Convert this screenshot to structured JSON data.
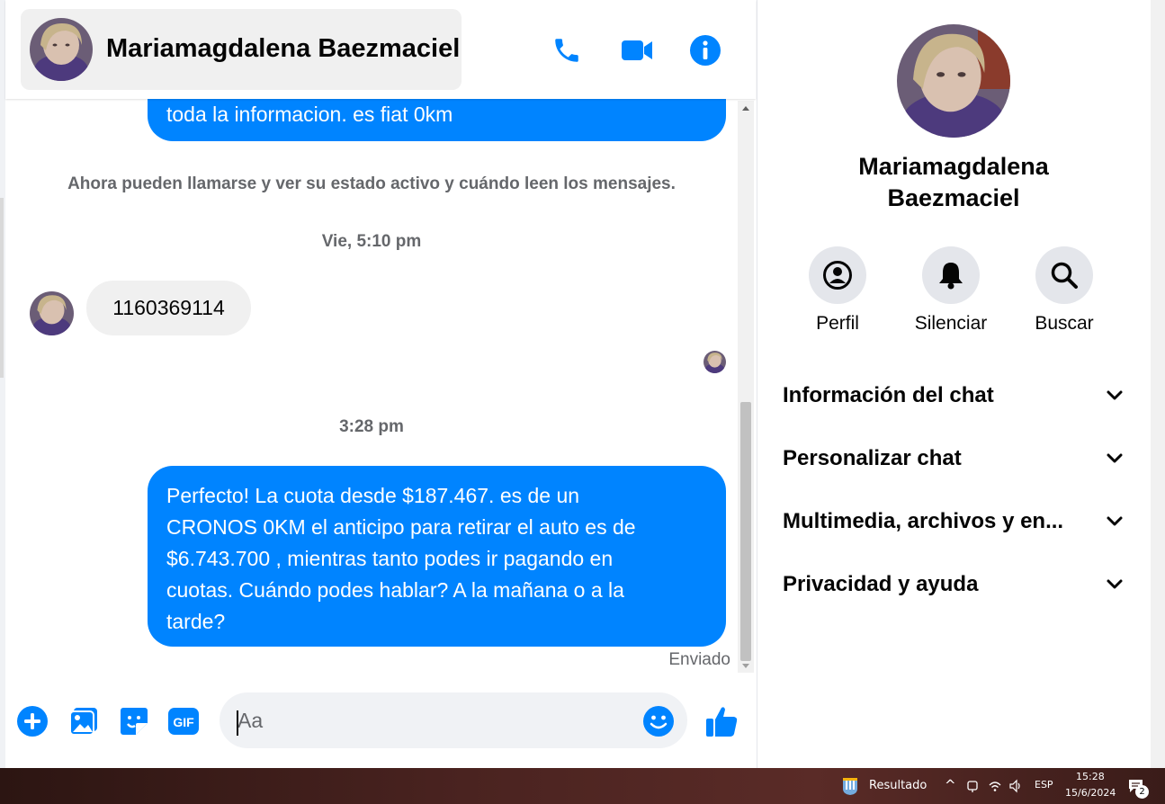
{
  "header": {
    "contact_name": "Mariamagdalena Baezmaciel",
    "icons": [
      "phone-icon",
      "video-call-icon",
      "info-icon"
    ]
  },
  "conversation": {
    "prev_message_tail": "toda la informacion. es fiat 0km",
    "system_notice": "Ahora pueden llamarse y ver su estado activo y cuándo leen los mensajes.",
    "timestamp_1": "Vie, 5:10 pm",
    "incoming_message": "1160369114",
    "timestamp_2": "3:28 pm",
    "outgoing_lines": [
      "Perfecto! La cuota desde $187.467. es de un",
      "CRONOS 0KM el anticipo para retirar el auto es de",
      "$6.743.700 , mientras tanto podes ir pagando en",
      "cuotas. Cuándo podes hablar? A la mañana o a la",
      "tarde?"
    ],
    "sent_status": "Enviado"
  },
  "composer": {
    "placeholder": "Aa",
    "icons": [
      "plus-icon",
      "photo-icon",
      "sticker-icon",
      "gif-icon",
      "emoji-icon",
      "like-icon"
    ],
    "gif_label": "GIF"
  },
  "info_panel": {
    "name_line1": "Mariamagdalena",
    "name_line2": "Baezmaciel",
    "actions": [
      {
        "label": "Perfil",
        "icon": "profile-icon"
      },
      {
        "label": "Silenciar",
        "icon": "bell-icon"
      },
      {
        "label": "Buscar",
        "icon": "search-icon"
      }
    ],
    "sections": [
      "Información del chat",
      "Personalizar chat",
      "Multimedia, archivos y en...",
      "Privacidad y ayuda"
    ]
  },
  "taskbar": {
    "widget_label": "Resultado",
    "language": "ESP",
    "time": "15:28",
    "date": "15/6/2024",
    "notification_count": "2"
  },
  "colors": {
    "accent": "#0084ff",
    "bubble_in": "#f0f0f0",
    "muted_text": "#65676b"
  }
}
